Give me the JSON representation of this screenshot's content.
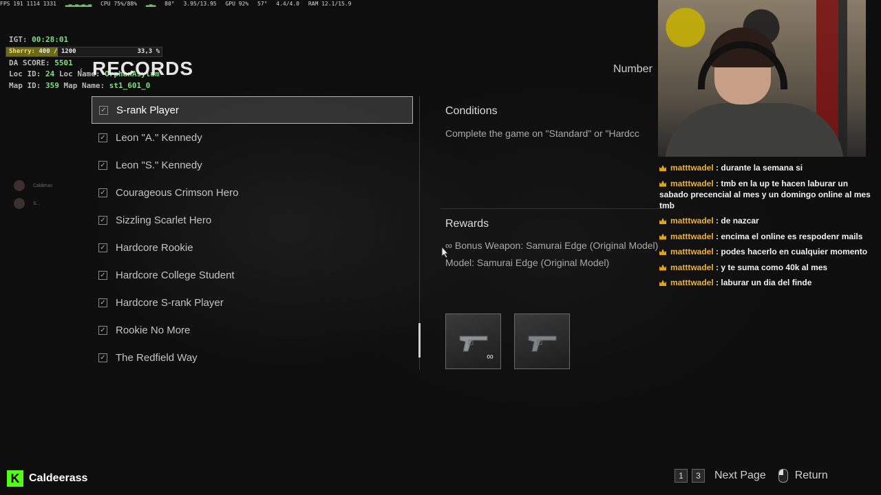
{
  "perf": {
    "fps": "FPS 191 1114 1331",
    "cpu": "CPU 75%/88%",
    "temp": "80°",
    "gpu_mem": "3.95/13.95",
    "gpu": "GPU 92%",
    "gpu_temp": "57°",
    "vram": "4.4/4.0",
    "ram": "RAM 12.1/15.9"
  },
  "overlay": {
    "igt_label": "IGT:",
    "igt_value": "00:28:01",
    "sherry_label": "Sherry:",
    "sherry_current": "400",
    "sherry_max": "/ 1200",
    "sherry_percent": "33,3 %",
    "sherry_fill": 0.333,
    "da_label": "DA SCORE:",
    "da_value": "5501",
    "loc_label": "Loc ID:",
    "loc_value": "24",
    "loc_name_label": "Loc Name:",
    "loc_name_value": "OrphanAsylum",
    "map_label": "Map ID:",
    "map_value": "359",
    "map_name_label": "Map Name:",
    "map_name_value": "st1_601_0"
  },
  "page": {
    "title": "RECORDS",
    "number_label": "Number"
  },
  "records": [
    {
      "label": "S-rank Player",
      "checked": true,
      "selected": true
    },
    {
      "label": "Leon \"A.\" Kennedy",
      "checked": true
    },
    {
      "label": "Leon \"S.\" Kennedy",
      "checked": true
    },
    {
      "label": "Courageous Crimson Hero",
      "checked": true
    },
    {
      "label": "Sizzling Scarlet Hero",
      "checked": true
    },
    {
      "label": "Hardcore Rookie",
      "checked": true
    },
    {
      "label": "Hardcore College Student",
      "checked": true
    },
    {
      "label": "Hardcore S-rank Player",
      "checked": true
    },
    {
      "label": "Rookie No More",
      "checked": true
    },
    {
      "label": "The Redfield Way",
      "checked": true
    }
  ],
  "detail": {
    "conditions_heading": "Conditions",
    "conditions_text": "Complete the game on \"Standard\" or \"Hardcc",
    "rewards_heading": "Rewards",
    "reward_line1": "∞ Bonus Weapon: Samurai Edge (Original Model)",
    "reward_line2": "Model: Samurai Edge (Original Model)",
    "infinity_badge": "∞"
  },
  "sidebar_users": [
    {
      "name": "Calderas"
    },
    {
      "name": "S..."
    }
  ],
  "chat": [
    {
      "user": "matttwadel",
      "text": ": durante la semana si"
    },
    {
      "user": "matttwadel",
      "text": ": tmb en la up te hacen laburar un sabado precencial al mes y un domingo online al mes tmb"
    },
    {
      "user": "matttwadel",
      "text": ": de nazcar"
    },
    {
      "user": "matttwadel",
      "text": ": encima el online es respodenr mails"
    },
    {
      "user": "matttwadel",
      "text": ": podes hacerlo en cualquier momento"
    },
    {
      "user": "matttwadel",
      "text": ": y te suma como 40k al mes"
    },
    {
      "user": "matttwadel",
      "text": ": laburar un dia del finde"
    }
  ],
  "footer": {
    "brand_logo": "K",
    "brand_name": "Caldeerass",
    "key1": "1",
    "key3": "3",
    "next_page": "Next Page",
    "return": "Return"
  },
  "colors": {
    "accent_green": "#53fc18",
    "chat_user": "#f0b234",
    "overlay_value": "#7fe07f"
  }
}
